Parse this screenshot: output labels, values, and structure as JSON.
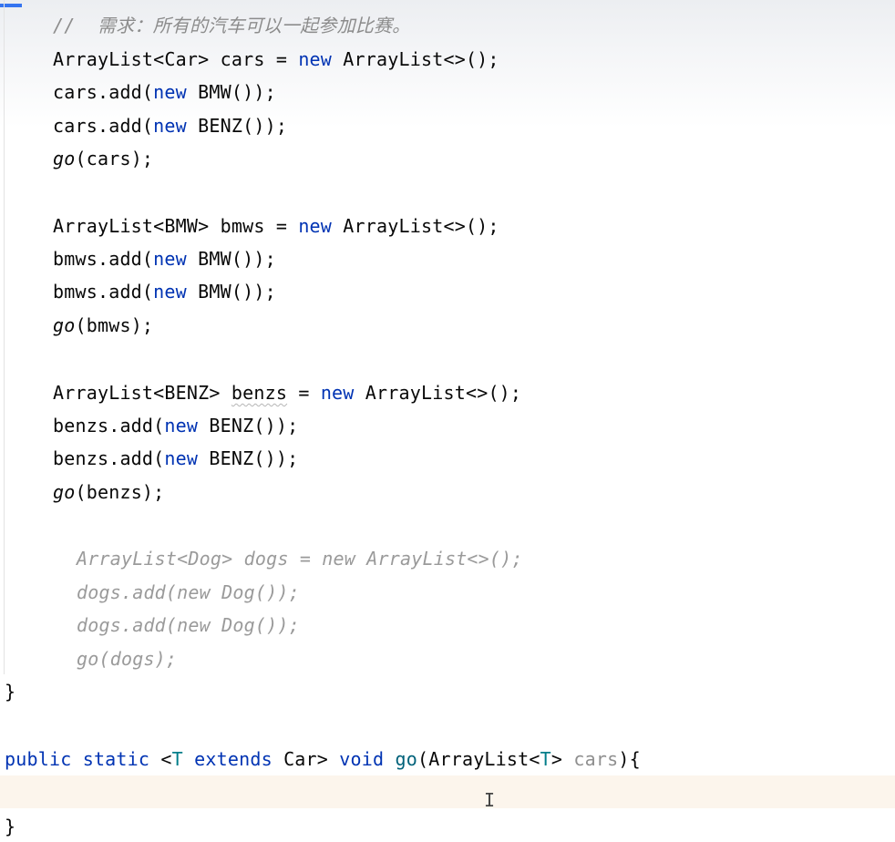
{
  "editor": {
    "comment": "//  需求：所有的汽车可以一起参加比赛。",
    "lines": {
      "l1": {
        "a": "ArrayList<Car> cars = ",
        "kw": "new",
        "b": " ArrayList<>();"
      },
      "l2": {
        "a": "cars.add(",
        "kw": "new",
        "b": " BMW());"
      },
      "l3": {
        "a": "cars.add(",
        "kw": "new",
        "b": " BENZ());"
      },
      "l4": {
        "call": "go",
        "b": "(cars);"
      },
      "l5": {
        "a": "ArrayList<BMW> bmws = ",
        "kw": "new",
        "b": " ArrayList<>();"
      },
      "l6": {
        "a": "bmws.add(",
        "kw": "new",
        "b": " BMW());"
      },
      "l7": {
        "a": "bmws.add(",
        "kw": "new",
        "b": " BMW());"
      },
      "l8": {
        "call": "go",
        "b": "(bmws);"
      },
      "l9": {
        "a": "ArrayList<BENZ> ",
        "var": "benzs",
        "c": " = ",
        "kw": "new",
        "b": " ArrayList<>();"
      },
      "l10": {
        "a": "benzs.add(",
        "kw": "new",
        "b": " BENZ());"
      },
      "l11": {
        "a": "benzs.add(",
        "kw": "new",
        "b": " BENZ());"
      },
      "l12": {
        "call": "go",
        "b": "(benzs);"
      },
      "l13": "ArrayList<Dog> dogs = new ArrayList<>();",
      "l14": "dogs.add(new Dog());",
      "l15": "dogs.add(new Dog());",
      "l16": "go(dogs);",
      "l17": "}",
      "l18": {
        "kw1": "public",
        "sp1": " ",
        "kw2": "static",
        "sp2": " <",
        "tp": "T",
        "sp3": " ",
        "kw3": "extends",
        "sp4": " Car> ",
        "kw4": "void",
        "sp5": " ",
        "fn": "go",
        "sp6": "(ArrayList<",
        "tp2": "T",
        "sp7": "> ",
        "param": "cars",
        "sp8": "){"
      },
      "l19": "}"
    },
    "cursor_glyph": "I"
  }
}
